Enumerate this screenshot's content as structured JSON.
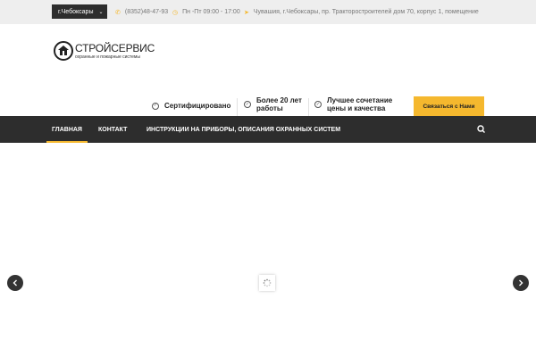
{
  "topbar": {
    "city_label": "г.Чебоксары",
    "phone": "(8352)48-47-93",
    "hours": "Пн -Пт 09:00 - 17:00",
    "address": "Чувашия, г.Чебоксары, пр. Тракторостроителей дом 70, корпус 1, помещение"
  },
  "logo": {
    "title": "СТРОЙСЕРВИС",
    "subtitle": "охранные и пожарные системы"
  },
  "features": [
    {
      "text": "Сертифицировано",
      "line2": ""
    },
    {
      "text": "Более 20 лет",
      "line2": "работы"
    },
    {
      "text": "Лучшее сочетание",
      "line2": "цены и качества"
    }
  ],
  "contact_button": "Связаться с Нами",
  "nav": {
    "items": [
      {
        "label": "ГЛАВНАЯ",
        "active": true
      },
      {
        "label": "КОНТАКТ",
        "active": false
      },
      {
        "label": "ИНСТРУКЦИИ НА ПРИБОРЫ, ОПИСАНИЯ ОХРАННЫХ СИСТЕМ",
        "active": false
      }
    ]
  },
  "slider": {
    "prev_icon": "chevron-left-icon",
    "next_icon": "chevron-right-icon",
    "loading_icon": "spinner-icon"
  },
  "colors": {
    "accent": "#f5b82e",
    "dark": "#2d2d2d",
    "topbar_bg": "#eeeeee"
  }
}
